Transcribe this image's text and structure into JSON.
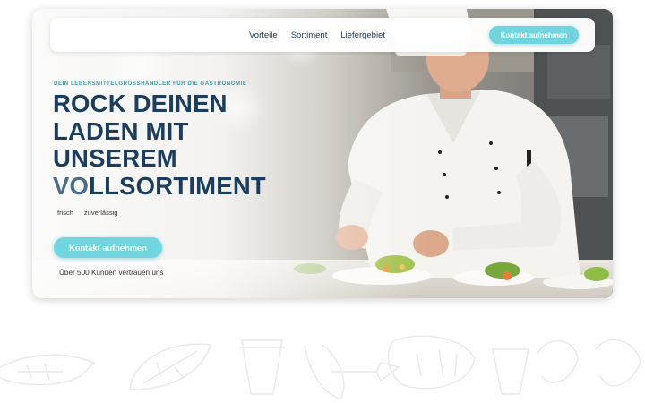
{
  "nav": {
    "links": [
      "Vorteile",
      "Sortiment",
      "Liefergebiet"
    ],
    "cta_label": "Kontakt aufnehmen"
  },
  "hero": {
    "kicker": "DEIN LEBENSMITTELGROSSHÄNDLER FÜR DIE GASTRONOMIE",
    "headline_lines": [
      "ROCK DEINEN",
      "LADEN MIT",
      "UNSEREM"
    ],
    "headline_last_accent": "VO",
    "headline_last_rest": "LLSORTIMENT",
    "tags": [
      "frisch",
      "zuverlässig"
    ],
    "cta_label": "Kontakt aufnehmen",
    "customers_text": "Über 500 Kunden vertrauen uns"
  },
  "colors": {
    "accent": "#6fd6e0",
    "headline": "#1b3d5e",
    "kicker": "#3b9fab"
  },
  "icons": {
    "photo": "chef-plating-food-photo",
    "background": "food-outline-illustrations"
  }
}
